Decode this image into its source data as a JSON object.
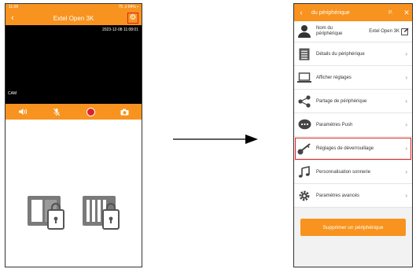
{
  "left_phone": {
    "status_time": "11:08",
    "status_right": "75 .ıl 84% ▪",
    "title": "Extel Open 3K",
    "timestamp": "2023-12-08 11:08:01",
    "cam_label": "CAM"
  },
  "right_phone": {
    "title": "du périphérique",
    "header_extra": "P.",
    "name_label_1": "Nom du",
    "name_label_2": "périphérique",
    "name_value": "Extel Open 3K",
    "menu": [
      {
        "label": "Détails du périphérique",
        "icon": "list-icon"
      },
      {
        "label": "Afficher réglages",
        "icon": "laptop-icon"
      },
      {
        "label": "Partage de périphérique",
        "icon": "share-icon"
      },
      {
        "label": "Paramètres Push",
        "icon": "chat-icon"
      },
      {
        "label": "Réglages de déverrouillage",
        "icon": "key-icon"
      },
      {
        "label": "Personnalisation sonnerie",
        "icon": "music-icon"
      },
      {
        "label": "Paramètres avancés",
        "icon": "gear-icon"
      }
    ],
    "delete_label": "Supprimer un périphérique"
  },
  "colors": {
    "accent": "#f7931e",
    "highlight": "#e02020"
  }
}
